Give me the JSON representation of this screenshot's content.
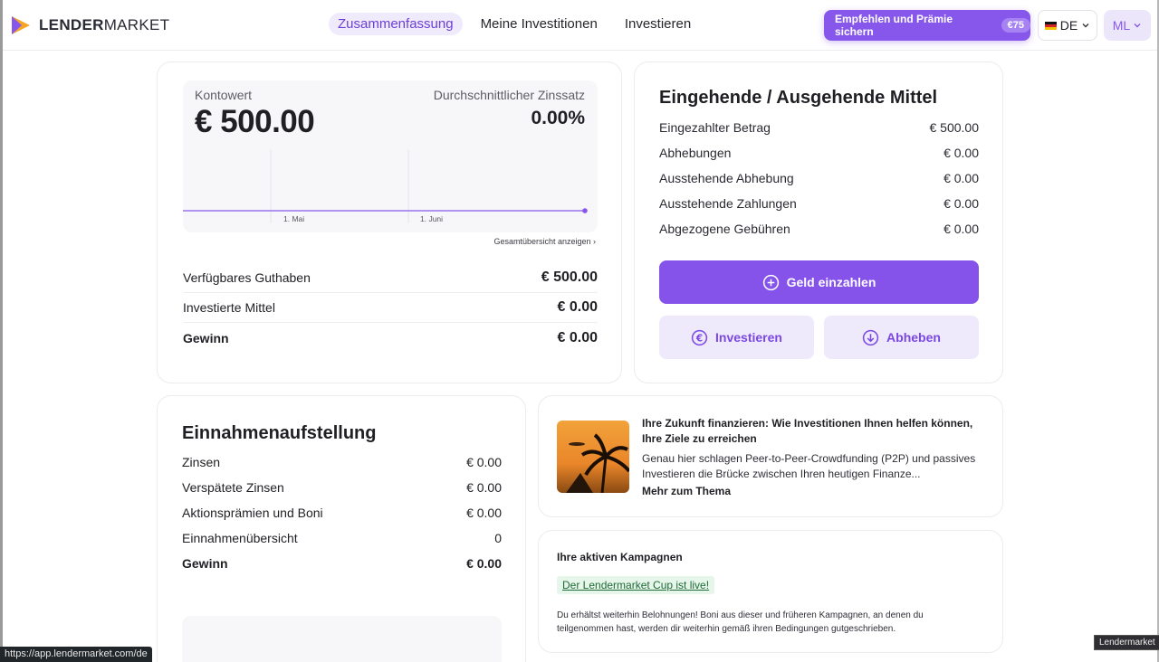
{
  "brand": {
    "name_bold": "LENDER",
    "name_rest": "MARKET"
  },
  "nav": [
    {
      "label": "Zusammenfassung",
      "active": true
    },
    {
      "label": "Meine Investitionen",
      "active": false
    },
    {
      "label": "Investieren",
      "active": false
    }
  ],
  "header": {
    "refer_label": "Empfehlen und Prämie sichern",
    "refer_badge": "€75",
    "language": "DE",
    "user_initials": "ML"
  },
  "account": {
    "kontowert_label": "Kontowert",
    "kontowert_value": "€ 500.00",
    "zins_label": "Durchschnittlicher Zinssatz",
    "zins_value": "0.00%",
    "chart_ticks": [
      "1. Mai",
      "1. Juni"
    ],
    "overview_link": "Gesamtübersicht anzeigen ›",
    "rows": [
      {
        "label": "Verfügbares Guthaben",
        "value": "€ 500.00"
      },
      {
        "label": "Investierte Mittel",
        "value": "€ 0.00"
      },
      {
        "label": "Gewinn",
        "value": "€ 0.00"
      }
    ]
  },
  "funds": {
    "title": "Eingehende / Ausgehende Mittel",
    "rows": [
      {
        "label": "Eingezahlter Betrag",
        "value": "€ 500.00"
      },
      {
        "label": "Abhebungen",
        "value": "€ 0.00"
      },
      {
        "label": "Ausstehende Abhebung",
        "value": "€ 0.00"
      },
      {
        "label": "Ausstehende Zahlungen",
        "value": "€ 0.00"
      },
      {
        "label": "Abgezogene Gebühren",
        "value": "€ 0.00"
      }
    ],
    "deposit_label": "Geld einzahlen",
    "invest_label": "Investieren",
    "withdraw_label": "Abheben"
  },
  "income": {
    "title": "Einnahmenaufstellung",
    "rows": [
      {
        "label": "Zinsen",
        "value": "€ 0.00"
      },
      {
        "label": "Verspätete Zinsen",
        "value": "€ 0.00"
      },
      {
        "label": "Aktionsprämien und Boni",
        "value": "€ 0.00"
      },
      {
        "label": "Einnahmenübersicht",
        "value": "0"
      },
      {
        "label": "Gewinn",
        "value": "€ 0.00"
      }
    ]
  },
  "article": {
    "title": "Ihre Zukunft finanzieren: Wie Investitionen Ihnen helfen können, Ihre Ziele zu erreichen",
    "text": "Genau hier schlagen Peer-to-Peer-Crowdfunding (P2P) und passives Investieren die Brücke zwischen Ihren heutigen Finanze...",
    "more_label": "Mehr zum Thema"
  },
  "campaigns": {
    "title": "Ihre aktiven Kampagnen",
    "link_label": "Der Lendermarket Cup ist live!",
    "text": "Du erhältst weiterhin Belohnungen! Boni aus dieser und früheren Kampagnen, an denen du teilgenommen hast, werden dir weiterhin gemäß ihren Bedingungen gutgeschrieben."
  },
  "status": {
    "url": "https://app.lendermarket.com/de",
    "tooltip": "Lendermarket"
  },
  "colors": {
    "accent": "#8757ec",
    "accent_light": "#efe9fc",
    "campaign_bg": "#e6f6ea"
  }
}
